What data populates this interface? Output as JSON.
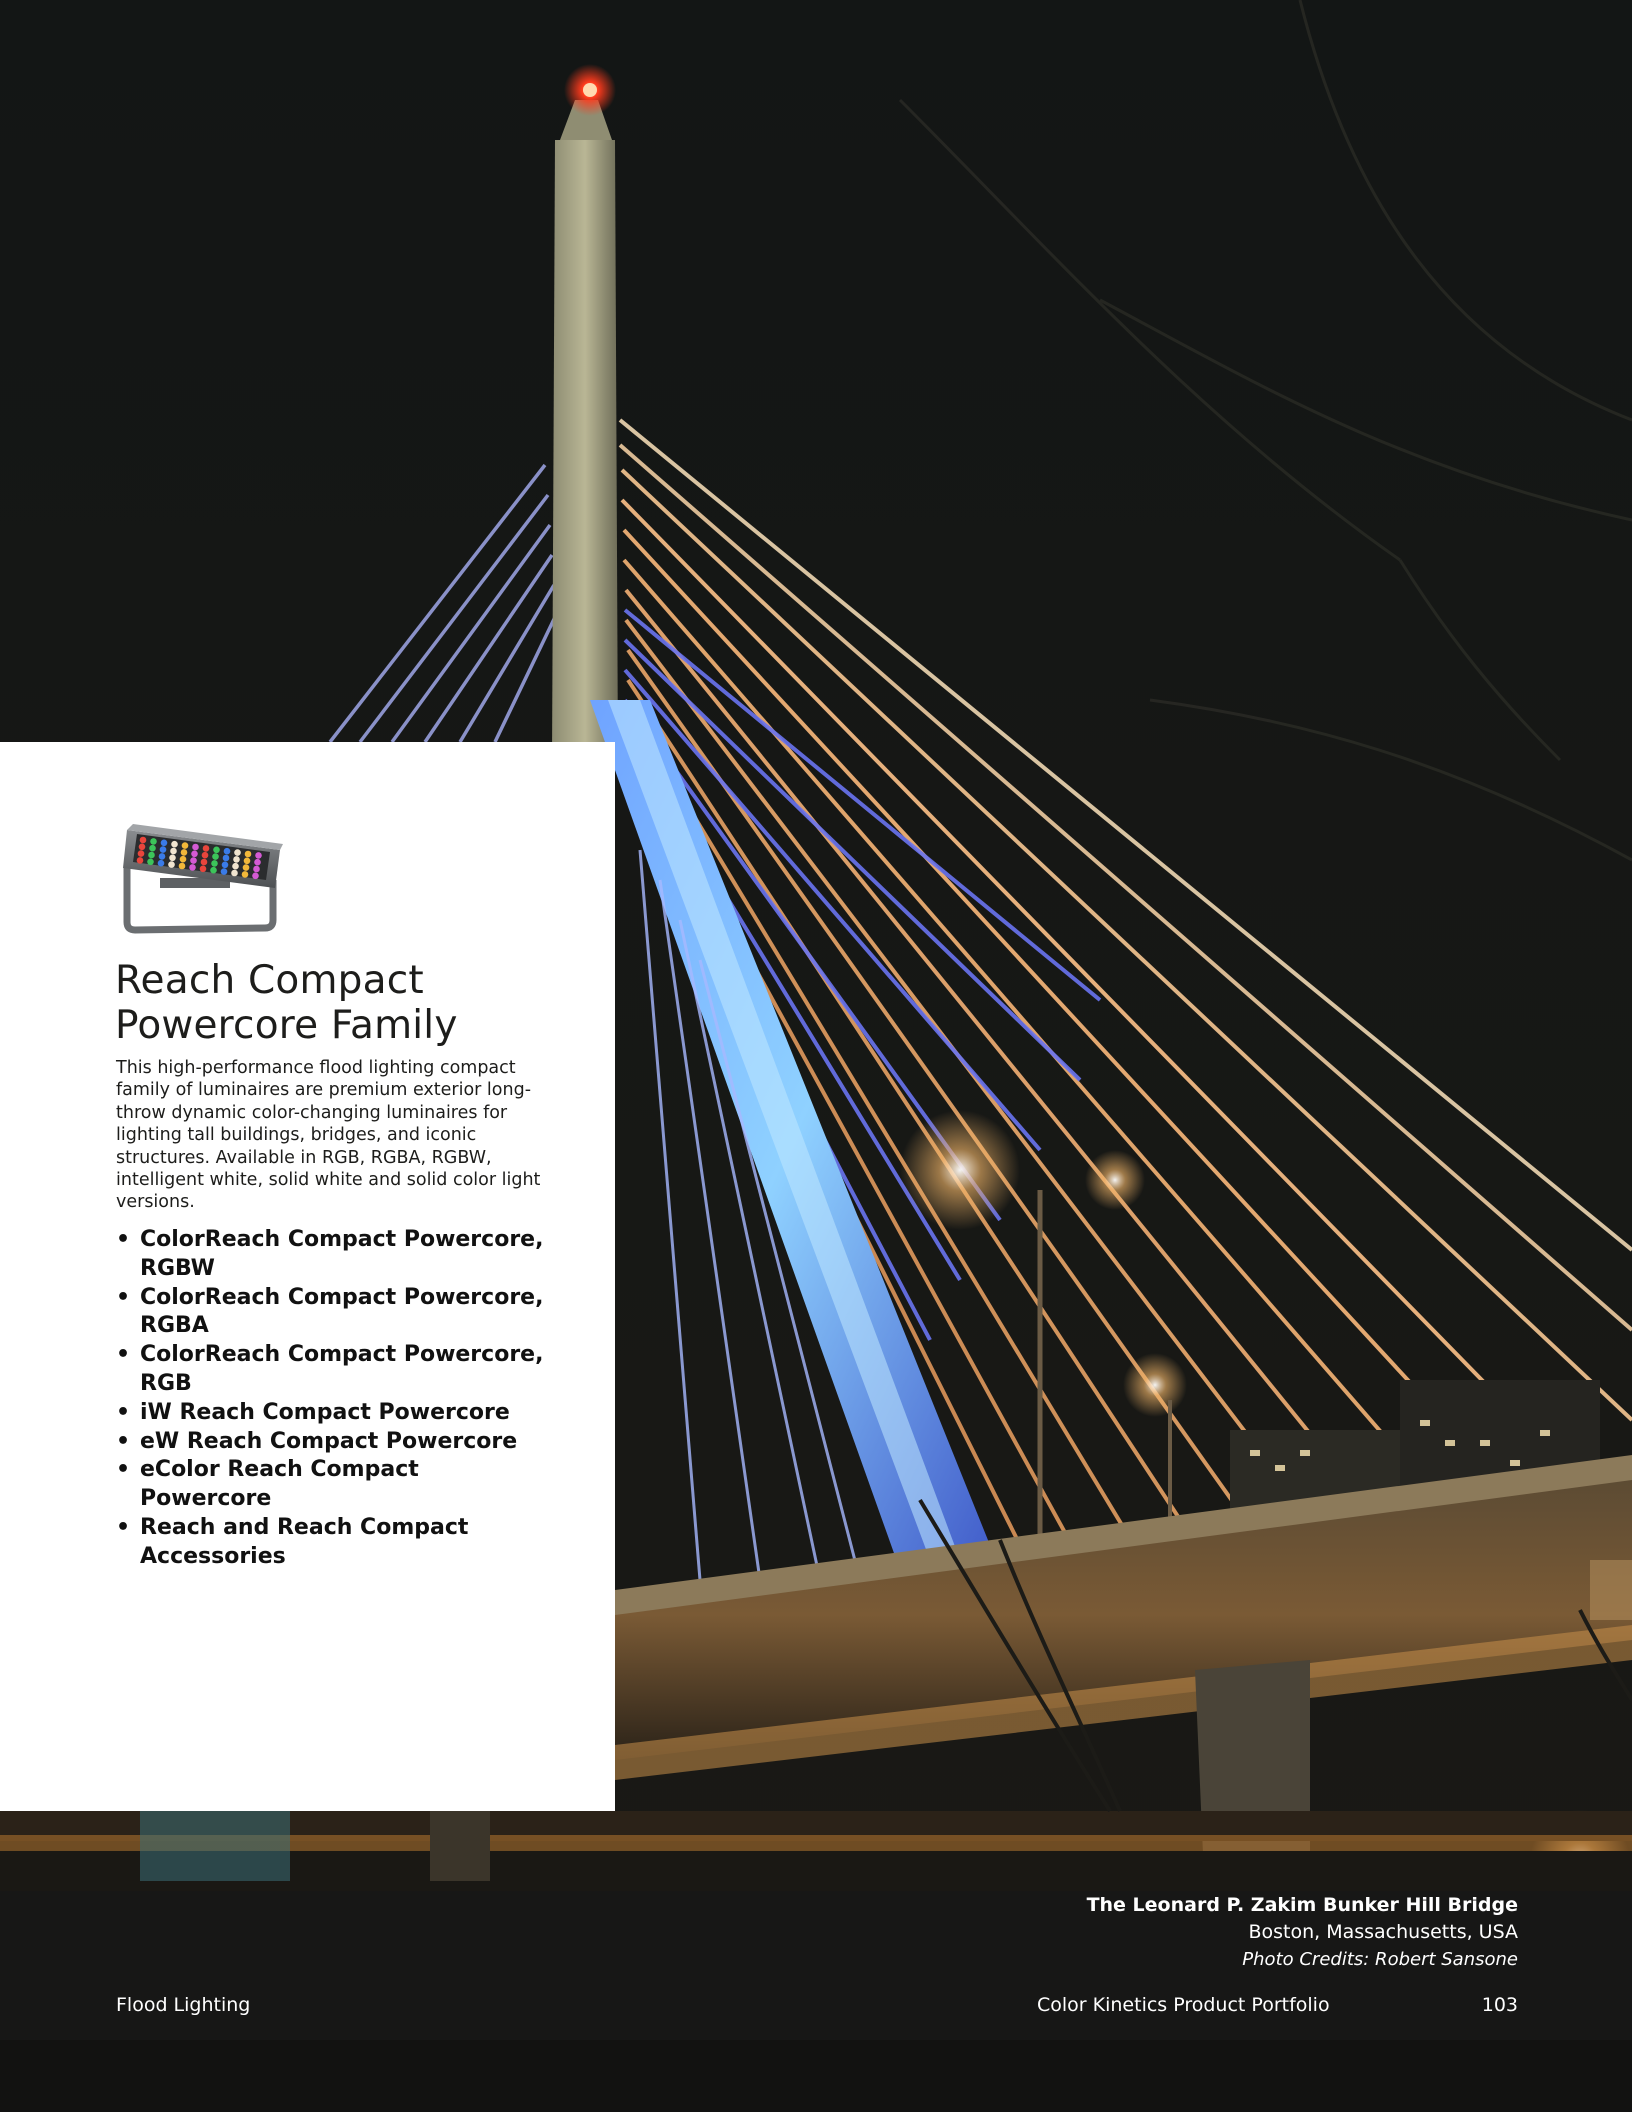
{
  "product": {
    "title_line1": "Reach Compact",
    "title_line2": "Powercore Family",
    "description": "This high-performance flood lighting compact family of luminaires are premium exterior long-throw dynamic color-changing luminaires for lighting tall buildings, bridges, and iconic structures. Available in RGB, RGBA, RGBW, intelligent white, solid white and solid color light versions.",
    "features": [
      "ColorReach Compact Powercore, RGBW",
      "ColorReach Compact Powercore, RGBA",
      "ColorReach Compact Powercore, RGB",
      "iW Reach Compact Powercore",
      "eW Reach Compact Powercore",
      "eColor Reach Compact Powercore",
      "Reach and Reach Compact Accessories"
    ],
    "bullet": "•"
  },
  "caption": {
    "title": "The Leonard P. Zakim Bunker Hill Bridge",
    "location": "Boston, Massachusetts, USA",
    "credit": "Photo Credits: Robert Sansone"
  },
  "footer": {
    "section": "Flood Lighting",
    "publication": "Color Kinetics Product Portfolio",
    "page_number": "103"
  },
  "colors": {
    "panel_background": "#ffffff",
    "night_sky": "#141615",
    "bridge_blue": "#5b6fe8",
    "cable_warm": "#e8b27a"
  },
  "icons": {
    "photo": "bridge-night-photo",
    "product": "flood-luminaire-image"
  }
}
